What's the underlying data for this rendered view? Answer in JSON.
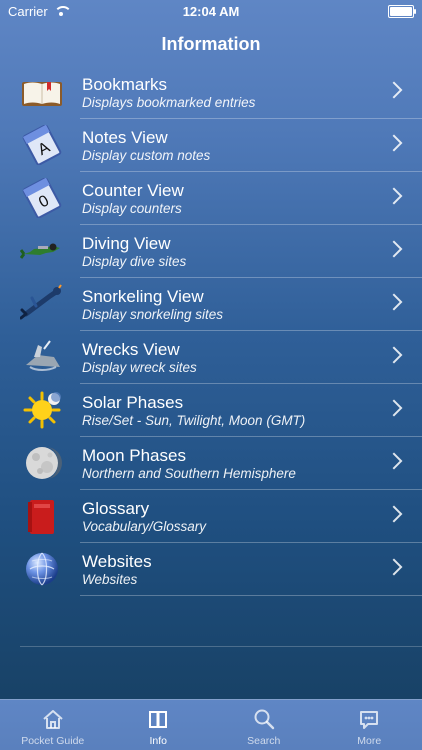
{
  "status": {
    "carrier": "Carrier",
    "time": "12:04 AM"
  },
  "nav": {
    "title": "Information"
  },
  "items": [
    {
      "title": "Bookmarks",
      "subtitle": "Displays bookmarked entries",
      "icon": "book-icon"
    },
    {
      "title": "Notes View",
      "subtitle": "Display custom notes",
      "icon": "notes-icon"
    },
    {
      "title": "Counter View",
      "subtitle": "Display counters",
      "icon": "counter-icon"
    },
    {
      "title": "Diving View",
      "subtitle": "Display dive sites",
      "icon": "diver-icon"
    },
    {
      "title": "Snorkeling View",
      "subtitle": "Display snorkeling sites",
      "icon": "snorkeler-icon"
    },
    {
      "title": "Wrecks View",
      "subtitle": "Display wreck sites",
      "icon": "wreck-icon"
    },
    {
      "title": "Solar Phases",
      "subtitle": "Rise/Set - Sun, Twilight, Moon (GMT)",
      "icon": "sun-icon"
    },
    {
      "title": "Moon Phases",
      "subtitle": "Northern and Southern Hemisphere",
      "icon": "moon-icon"
    },
    {
      "title": "Glossary",
      "subtitle": "Vocabulary/Glossary",
      "icon": "glossary-icon"
    },
    {
      "title": "Websites",
      "subtitle": "Websites",
      "icon": "globe-icon"
    }
  ],
  "tabs": [
    {
      "label": "Pocket Guide",
      "icon": "home-icon",
      "active": false
    },
    {
      "label": "Info",
      "icon": "book-icon",
      "active": true
    },
    {
      "label": "Search",
      "icon": "search-icon",
      "active": false
    },
    {
      "label": "More",
      "icon": "more-icon",
      "active": false
    }
  ]
}
